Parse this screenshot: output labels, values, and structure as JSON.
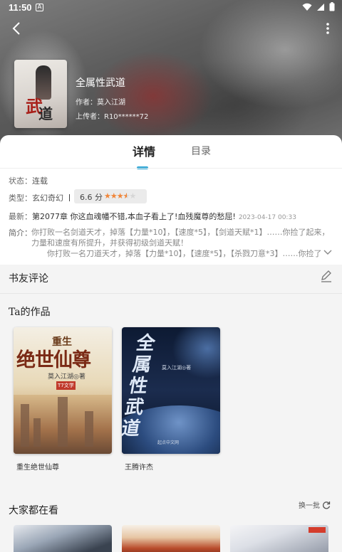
{
  "status_bar": {
    "time": "11:50"
  },
  "book": {
    "title": "全属性武道",
    "author": "作者：莫入江湖",
    "uploader": "上传者：R10******72"
  },
  "tabs": [
    {
      "label": "详情",
      "active": true
    },
    {
      "label": "目录",
      "active": false
    }
  ],
  "details": {
    "status_label": "状态：",
    "status_value": "连载",
    "type_label": "类型：",
    "type_value": "玄幻奇幻",
    "score": "6.6 分",
    "rating_stars": 3.5,
    "latest_label": "最新：",
    "latest_chapter": "第2077章 你这血魂幡不错,本血子看上了!血残魔尊的愁屈!",
    "latest_date": "2023-04-17 00:33",
    "intro_label": "简介：",
    "intro_line1": "你打败一名剑道天才，掉落【力量*10】，【速度*5】，【剑道天赋*1】……你捡了起来，",
    "intro_line2": "力量和速度有所提升，并获得初级剑道天赋！",
    "intro_line3": "你打败一名刀道天才，掉落【力量*10】，【速度*5】，【杀戮刀意*3】……你捡了"
  },
  "comments": {
    "title": "书友评论"
  },
  "author_works": {
    "title": "Ta的作品",
    "items": [
      {
        "name": "重生绝世仙尊",
        "cover_top": "重生",
        "cover_main": "绝世仙尊",
        "cover_author": "莫入江湖◎著",
        "cover_tag": "T7文学"
      },
      {
        "name": "王腾许杰",
        "cover_main": "全属性武道",
        "cover_author": "莫入江湖◎著",
        "cover_pub": "起点中文网"
      }
    ]
  },
  "popular": {
    "title": "大家都在看",
    "refresh_label": "换一批"
  },
  "colors": {
    "accent": "#21a0d2",
    "star": "#f0863a"
  }
}
